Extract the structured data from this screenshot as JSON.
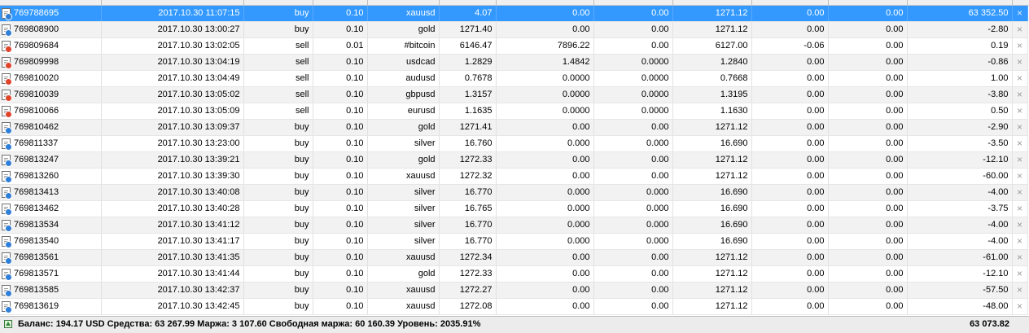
{
  "orders": [
    {
      "ticket": "769788695",
      "time": "2017.10.30 11:07:15",
      "type": "buy",
      "size": "0.10",
      "symbol": "xauusd",
      "price": "4.07",
      "sl": "0.00",
      "tp": "0.00",
      "cur_price": "1271.12",
      "commission": "0.00",
      "swap": "0.00",
      "profit": "63 352.50",
      "selected": true
    },
    {
      "ticket": "769808900",
      "time": "2017.10.30 13:00:27",
      "type": "buy",
      "size": "0.10",
      "symbol": "gold",
      "price": "1271.40",
      "sl": "0.00",
      "tp": "0.00",
      "cur_price": "1271.12",
      "commission": "0.00",
      "swap": "0.00",
      "profit": "-2.80"
    },
    {
      "ticket": "769809684",
      "time": "2017.10.30 13:02:05",
      "type": "sell",
      "size": "0.01",
      "symbol": "#bitcoin",
      "price": "6146.47",
      "sl": "7896.22",
      "tp": "0.00",
      "cur_price": "6127.00",
      "commission": "-0.06",
      "swap": "0.00",
      "profit": "0.19"
    },
    {
      "ticket": "769809998",
      "time": "2017.10.30 13:04:19",
      "type": "sell",
      "size": "0.10",
      "symbol": "usdcad",
      "price": "1.2829",
      "sl": "1.4842",
      "tp": "0.0000",
      "cur_price": "1.2840",
      "commission": "0.00",
      "swap": "0.00",
      "profit": "-0.86"
    },
    {
      "ticket": "769810020",
      "time": "2017.10.30 13:04:49",
      "type": "sell",
      "size": "0.10",
      "symbol": "audusd",
      "price": "0.7678",
      "sl": "0.0000",
      "tp": "0.0000",
      "cur_price": "0.7668",
      "commission": "0.00",
      "swap": "0.00",
      "profit": "1.00"
    },
    {
      "ticket": "769810039",
      "time": "2017.10.30 13:05:02",
      "type": "sell",
      "size": "0.10",
      "symbol": "gbpusd",
      "price": "1.3157",
      "sl": "0.0000",
      "tp": "0.0000",
      "cur_price": "1.3195",
      "commission": "0.00",
      "swap": "0.00",
      "profit": "-3.80"
    },
    {
      "ticket": "769810066",
      "time": "2017.10.30 13:05:09",
      "type": "sell",
      "size": "0.10",
      "symbol": "eurusd",
      "price": "1.1635",
      "sl": "0.0000",
      "tp": "0.0000",
      "cur_price": "1.1630",
      "commission": "0.00",
      "swap": "0.00",
      "profit": "0.50"
    },
    {
      "ticket": "769810462",
      "time": "2017.10.30 13:09:37",
      "type": "buy",
      "size": "0.10",
      "symbol": "gold",
      "price": "1271.41",
      "sl": "0.00",
      "tp": "0.00",
      "cur_price": "1271.12",
      "commission": "0.00",
      "swap": "0.00",
      "profit": "-2.90"
    },
    {
      "ticket": "769811337",
      "time": "2017.10.30 13:23:00",
      "type": "buy",
      "size": "0.10",
      "symbol": "silver",
      "price": "16.760",
      "sl": "0.000",
      "tp": "0.000",
      "cur_price": "16.690",
      "commission": "0.00",
      "swap": "0.00",
      "profit": "-3.50"
    },
    {
      "ticket": "769813247",
      "time": "2017.10.30 13:39:21",
      "type": "buy",
      "size": "0.10",
      "symbol": "gold",
      "price": "1272.33",
      "sl": "0.00",
      "tp": "0.00",
      "cur_price": "1271.12",
      "commission": "0.00",
      "swap": "0.00",
      "profit": "-12.10"
    },
    {
      "ticket": "769813260",
      "time": "2017.10.30 13:39:30",
      "type": "buy",
      "size": "0.10",
      "symbol": "xauusd",
      "price": "1272.32",
      "sl": "0.00",
      "tp": "0.00",
      "cur_price": "1271.12",
      "commission": "0.00",
      "swap": "0.00",
      "profit": "-60.00"
    },
    {
      "ticket": "769813413",
      "time": "2017.10.30 13:40:08",
      "type": "buy",
      "size": "0.10",
      "symbol": "silver",
      "price": "16.770",
      "sl": "0.000",
      "tp": "0.000",
      "cur_price": "16.690",
      "commission": "0.00",
      "swap": "0.00",
      "profit": "-4.00"
    },
    {
      "ticket": "769813462",
      "time": "2017.10.30 13:40:28",
      "type": "buy",
      "size": "0.10",
      "symbol": "silver",
      "price": "16.765",
      "sl": "0.000",
      "tp": "0.000",
      "cur_price": "16.690",
      "commission": "0.00",
      "swap": "0.00",
      "profit": "-3.75"
    },
    {
      "ticket": "769813534",
      "time": "2017.10.30 13:41:12",
      "type": "buy",
      "size": "0.10",
      "symbol": "silver",
      "price": "16.770",
      "sl": "0.000",
      "tp": "0.000",
      "cur_price": "16.690",
      "commission": "0.00",
      "swap": "0.00",
      "profit": "-4.00"
    },
    {
      "ticket": "769813540",
      "time": "2017.10.30 13:41:17",
      "type": "buy",
      "size": "0.10",
      "symbol": "silver",
      "price": "16.770",
      "sl": "0.000",
      "tp": "0.000",
      "cur_price": "16.690",
      "commission": "0.00",
      "swap": "0.00",
      "profit": "-4.00"
    },
    {
      "ticket": "769813561",
      "time": "2017.10.30 13:41:35",
      "type": "buy",
      "size": "0.10",
      "symbol": "xauusd",
      "price": "1272.34",
      "sl": "0.00",
      "tp": "0.00",
      "cur_price": "1271.12",
      "commission": "0.00",
      "swap": "0.00",
      "profit": "-61.00"
    },
    {
      "ticket": "769813571",
      "time": "2017.10.30 13:41:44",
      "type": "buy",
      "size": "0.10",
      "symbol": "gold",
      "price": "1272.33",
      "sl": "0.00",
      "tp": "0.00",
      "cur_price": "1271.12",
      "commission": "0.00",
      "swap": "0.00",
      "profit": "-12.10"
    },
    {
      "ticket": "769813585",
      "time": "2017.10.30 13:42:37",
      "type": "buy",
      "size": "0.10",
      "symbol": "xauusd",
      "price": "1272.27",
      "sl": "0.00",
      "tp": "0.00",
      "cur_price": "1271.12",
      "commission": "0.00",
      "swap": "0.00",
      "profit": "-57.50"
    },
    {
      "ticket": "769813619",
      "time": "2017.10.30 13:42:45",
      "type": "buy",
      "size": "0.10",
      "symbol": "xauusd",
      "price": "1272.08",
      "sl": "0.00",
      "tp": "0.00",
      "cur_price": "1271.12",
      "commission": "0.00",
      "swap": "0.00",
      "profit": "-48.00"
    }
  ],
  "icons": {
    "order_icon": "document-icon",
    "buy_marker_color": "#2f7fd8",
    "sell_marker_color": "#e0442b",
    "close_icon": "close-icon",
    "close_glyph": "×",
    "status_icon": "green-up-arrow-icon"
  },
  "colors": {
    "selected_row": "#3399ff"
  },
  "status_bar": {
    "summary": "Баланс: 194.17 USD  Средства: 63 267.99  Маржа: 3 107.60  Свободная маржа: 60 160.39  Уровень: 2035.91%",
    "total_profit": "63 073.82"
  }
}
